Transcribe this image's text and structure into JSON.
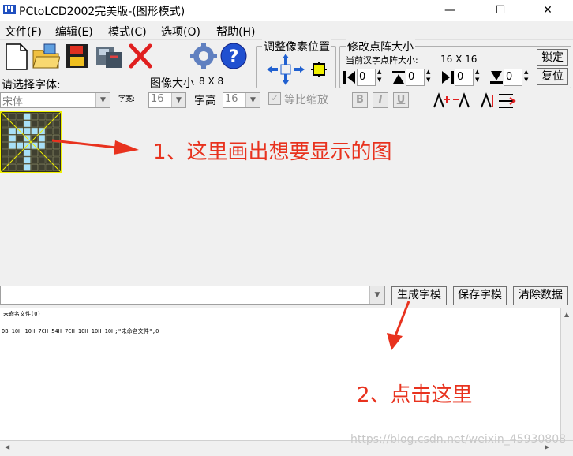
{
  "window": {
    "title": "PCtoLCD2002完美版-(图形模式)",
    "minimize": "—",
    "maximize": "☐",
    "close": "✕"
  },
  "menu": [
    "文件(F)",
    "编辑(E)",
    "模式(C)",
    "选项(O)",
    "帮助(H)"
  ],
  "font_panel": {
    "select_font_label": "请选择字体:",
    "font_value": "宋体",
    "char_width_label": "字宽:",
    "char_width_value": "16",
    "char_height_label": "字高",
    "char_height_value": "16",
    "image_size_label": "图像大小",
    "image_size_value": "8 X 8",
    "proportional_label": "等比缩放",
    "bold": "B",
    "italic": "I",
    "underline": "U"
  },
  "adjust_position": {
    "title": "调整像素位置"
  },
  "modify_matrix": {
    "title": "修改点阵大小",
    "current_label": "当前汉字点阵大小:",
    "current_value": "16 X 16",
    "lock_button": "锁定",
    "reset_button": "复位",
    "spin_values": [
      "0",
      "0",
      "0",
      "0"
    ]
  },
  "actions": {
    "generate": "生成字模",
    "save": "保存字模",
    "clear": "清除数据"
  },
  "output": {
    "line1": "未命名文件(0)",
    "line2": "DB 10H 10H 7CH 54H 7CH 10H 10H 10H;\"未命名文件\",0"
  },
  "annotations": {
    "step1": "1、这里画出想要显示的图",
    "step2": "2、点击这里"
  },
  "watermark": "https://blog.csdn.net/weixin_45930808",
  "pixel_grid": [
    [
      0,
      0,
      0,
      1,
      0,
      0,
      0,
      0
    ],
    [
      0,
      0,
      0,
      1,
      0,
      0,
      0,
      0
    ],
    [
      0,
      1,
      1,
      1,
      1,
      1,
      0,
      0
    ],
    [
      0,
      1,
      0,
      1,
      0,
      1,
      0,
      0
    ],
    [
      0,
      1,
      1,
      1,
      1,
      1,
      0,
      0
    ],
    [
      0,
      0,
      0,
      1,
      0,
      0,
      0,
      0
    ],
    [
      0,
      0,
      0,
      1,
      0,
      0,
      0,
      0
    ],
    [
      0,
      0,
      0,
      1,
      0,
      0,
      0,
      0
    ]
  ]
}
